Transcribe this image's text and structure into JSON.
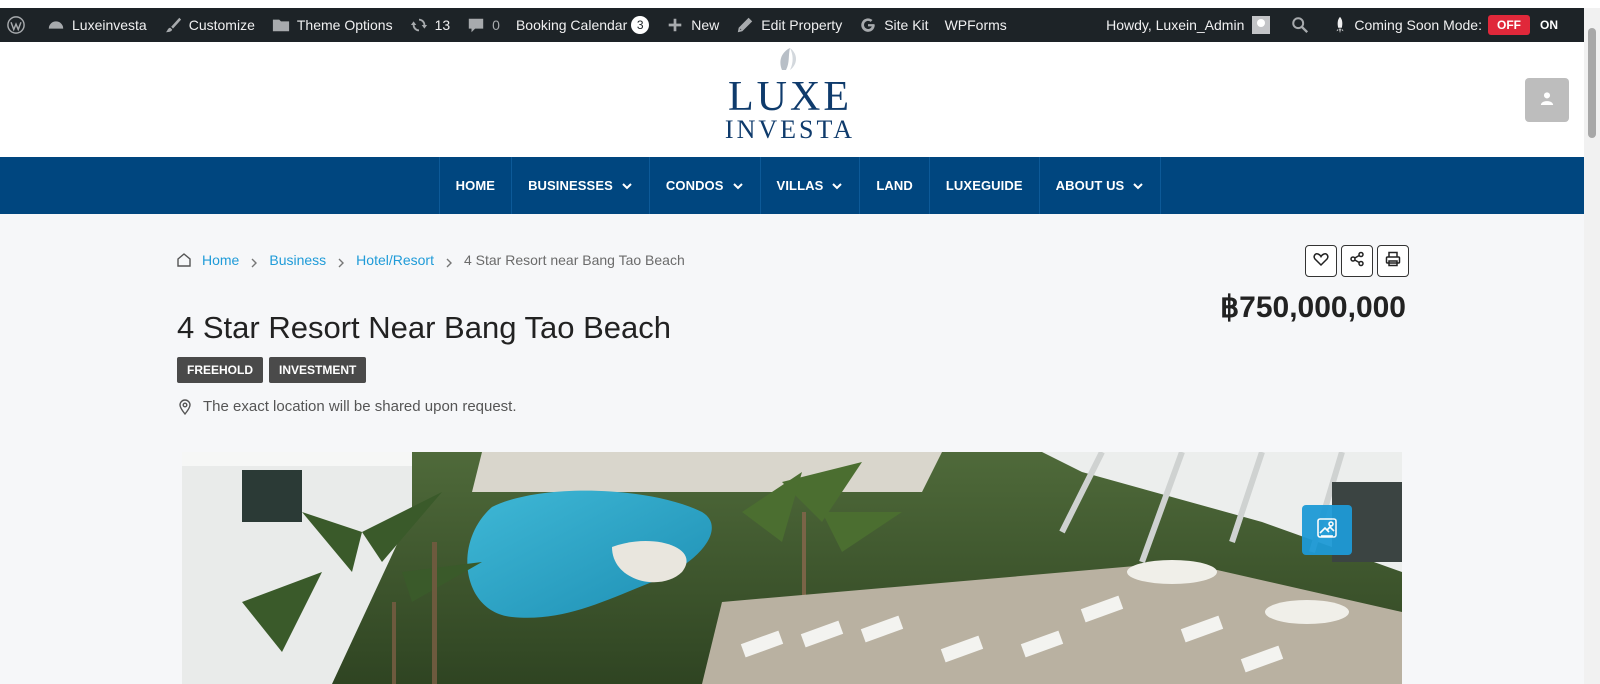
{
  "adminbar": {
    "items": [
      {
        "label": "Luxeinvesta",
        "icon": "dashboard-icon"
      },
      {
        "label": "Customize",
        "icon": "brush-icon"
      },
      {
        "label": "Theme Options",
        "icon": "folder-icon"
      },
      {
        "label": "13",
        "icon": "updates-icon"
      },
      {
        "label": "0",
        "icon": "comment-icon"
      },
      {
        "label": "Booking Calendar",
        "count": "3"
      },
      {
        "label": "New",
        "icon": "plus-icon"
      },
      {
        "label": "Edit Property",
        "icon": "pencil-icon"
      },
      {
        "label": "Site Kit",
        "icon": "google-icon"
      },
      {
        "label": "WPForms"
      }
    ],
    "howdy": "Howdy, Luxein_Admin",
    "coming_soon_label": "Coming Soon Mode:",
    "off_label": "OFF",
    "on_label": "ON"
  },
  "logo": {
    "line1": "LUXE",
    "line2": "INVESTA"
  },
  "nav": {
    "items": [
      {
        "label": "HOME",
        "dropdown": false
      },
      {
        "label": "BUSINESSES",
        "dropdown": true
      },
      {
        "label": "CONDOS",
        "dropdown": true
      },
      {
        "label": "VILLAS",
        "dropdown": true
      },
      {
        "label": "LAND",
        "dropdown": false
      },
      {
        "label": "LUXEGUIDE",
        "dropdown": false
      },
      {
        "label": "ABOUT US",
        "dropdown": true
      }
    ]
  },
  "breadcrumb": {
    "home": "Home",
    "business": "Business",
    "category": "Hotel/Resort",
    "current": "4 Star Resort near Bang Tao Beach"
  },
  "listing": {
    "title": "4 Star Resort Near Bang Tao Beach",
    "price": "฿750,000,000",
    "tags": [
      "FREEHOLD",
      "INVESTMENT"
    ],
    "location": "The exact location will be shared upon request."
  },
  "colors": {
    "nav_bg": "#00467f",
    "link": "#1f9bd8",
    "off_red": "#e0283a",
    "gallery_btn": "#1e9ad6"
  }
}
